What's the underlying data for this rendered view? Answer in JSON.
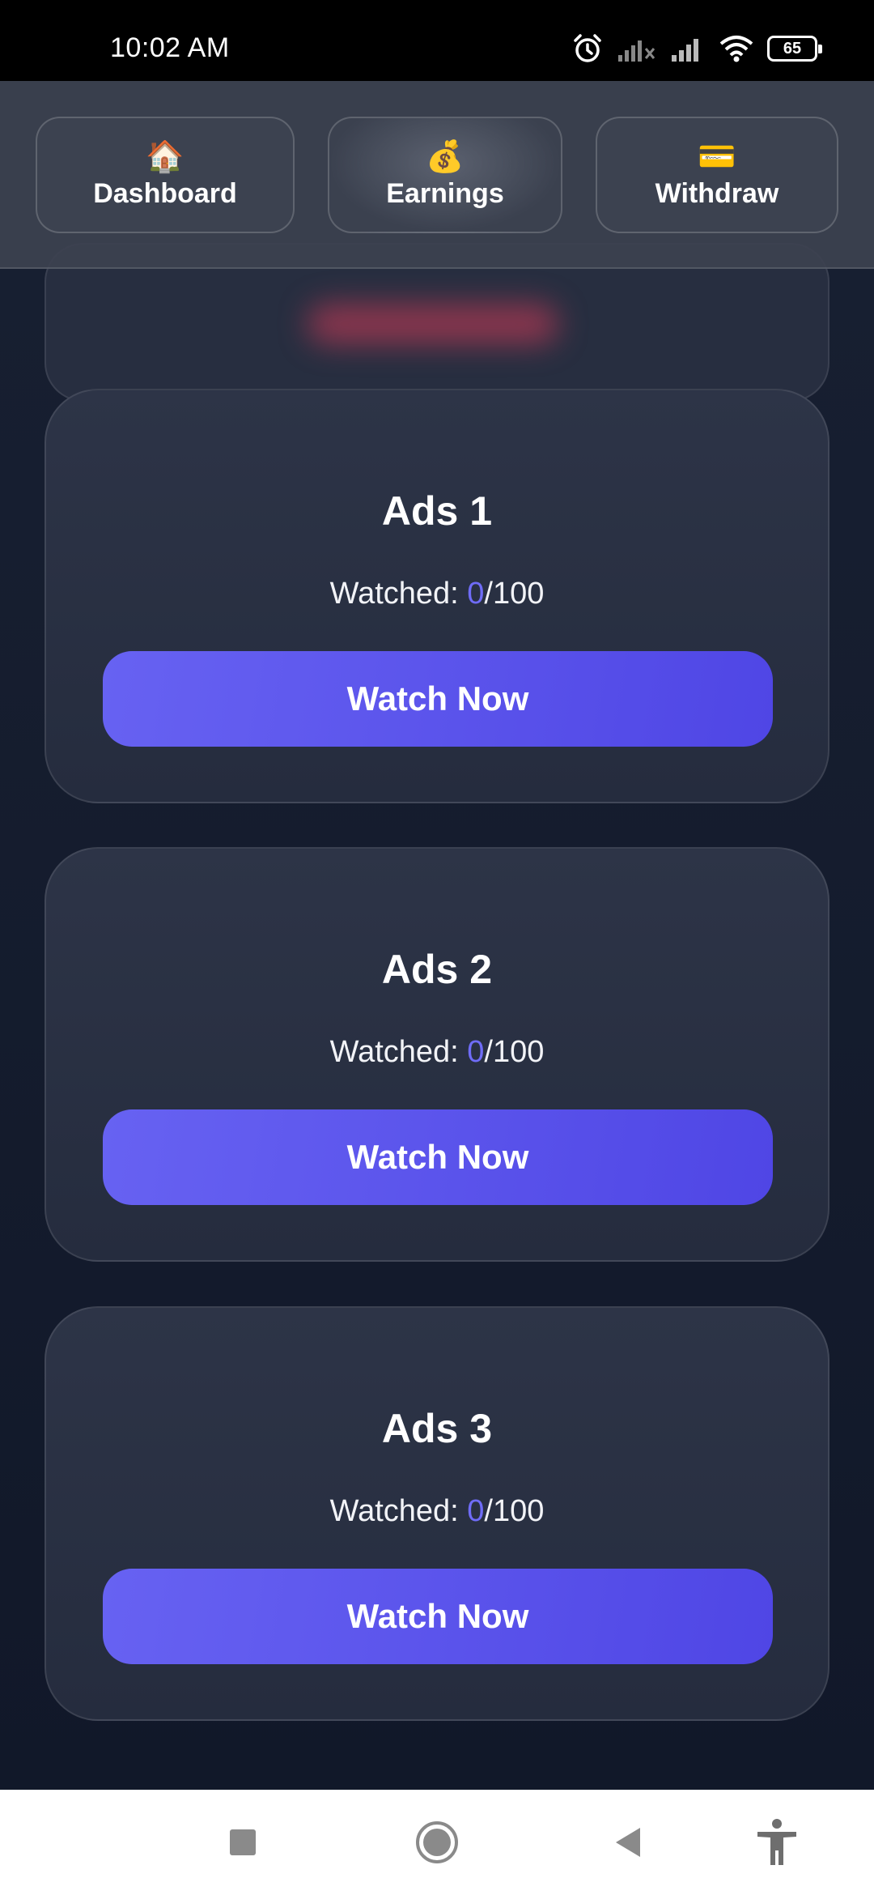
{
  "status_bar": {
    "time": "10:02 AM",
    "battery": "65",
    "icons": [
      "alarm-icon",
      "signal-x-icon",
      "signal-icon",
      "wifi-icon",
      "battery-icon"
    ]
  },
  "nav": {
    "items": [
      {
        "icon": "🏠",
        "icon_name": "home-icon",
        "label": "Dashboard"
      },
      {
        "icon": "💰",
        "icon_name": "money-bag-icon",
        "label": "Earnings"
      },
      {
        "icon": "💳",
        "icon_name": "credit-card-icon",
        "label": "Withdraw"
      }
    ],
    "active": "Earnings"
  },
  "ads": [
    {
      "title": "Ads 1",
      "watched_prefix": "Watched: ",
      "watched_count": "0",
      "watched_total": "/100",
      "button": "Watch Now"
    },
    {
      "title": "Ads 2",
      "watched_prefix": "Watched: ",
      "watched_count": "0",
      "watched_total": "/100",
      "button": "Watch Now"
    },
    {
      "title": "Ads 3",
      "watched_prefix": "Watched: ",
      "watched_count": "0",
      "watched_total": "/100",
      "button": "Watch Now"
    }
  ],
  "system_nav": {
    "icons": [
      "recents-square-icon",
      "home-circle-icon",
      "back-triangle-icon",
      "accessibility-icon"
    ]
  },
  "colors": {
    "background": "#161d2e",
    "card": "#2b3245",
    "accent": "#5b55ef",
    "count_accent": "#6f6cf7"
  }
}
